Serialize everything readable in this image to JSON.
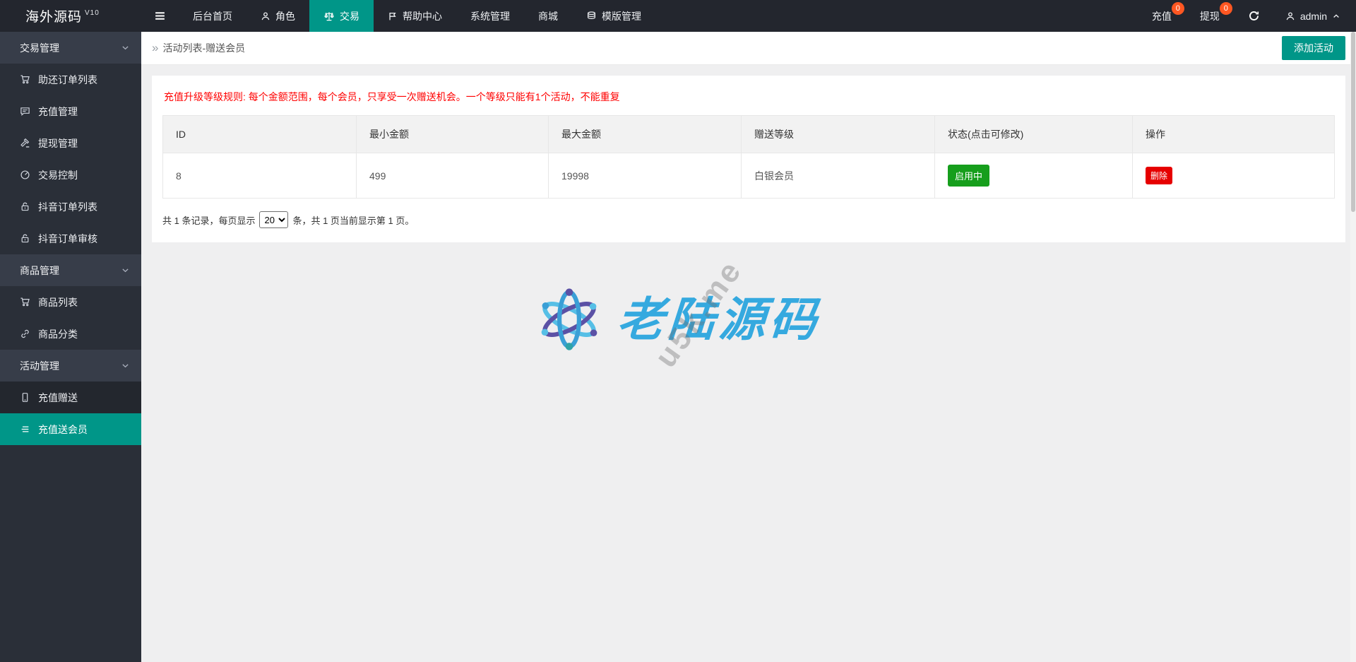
{
  "topbar": {
    "logo_text": "海外源码",
    "logo_version": "V10",
    "nav": [
      {
        "label": "后台首页"
      },
      {
        "label": "角色",
        "icon": "user-icon"
      },
      {
        "label": "交易",
        "icon": "scales-icon",
        "active": true
      },
      {
        "label": "帮助中心",
        "icon": "flag-icon"
      },
      {
        "label": "系统管理"
      },
      {
        "label": "商城"
      },
      {
        "label": "模版管理",
        "icon": "layers-icon"
      }
    ],
    "quick_actions": [
      {
        "label": "充值",
        "badge": "0"
      },
      {
        "label": "提现",
        "badge": "0"
      }
    ],
    "refresh_icon": "refresh-icon",
    "user": {
      "name": "admin",
      "icon": "user-icon",
      "chevron": "chevron-up-icon"
    }
  },
  "sidebar": {
    "items": [
      {
        "type": "group",
        "label": "交易管理",
        "chevron": "chevron-down-icon"
      },
      {
        "type": "item",
        "label": "助还订单列表",
        "icon": "cart-icon"
      },
      {
        "type": "item",
        "label": "充值管理",
        "icon": "comment-icon"
      },
      {
        "type": "item",
        "label": "提现管理",
        "icon": "gavel-icon"
      },
      {
        "type": "item",
        "label": "交易控制",
        "icon": "gauge-icon"
      },
      {
        "type": "item",
        "label": "抖音订单列表",
        "icon": "lock-icon"
      },
      {
        "type": "item",
        "label": "抖音订单审核",
        "icon": "lock-icon"
      },
      {
        "type": "group",
        "label": "商品管理",
        "chevron": "chevron-down-icon"
      },
      {
        "type": "item",
        "label": "商品列表",
        "icon": "cart-icon"
      },
      {
        "type": "item",
        "label": "商品分类",
        "icon": "link-icon"
      },
      {
        "type": "group",
        "label": "活动管理",
        "chevron": "chevron-down-icon"
      },
      {
        "type": "item",
        "label": "充值赠送",
        "icon": "mobile-icon"
      },
      {
        "type": "item",
        "label": "充值送会员",
        "icon": "list-icon",
        "active": true
      }
    ]
  },
  "breadcrumb": {
    "title": "活动列表-赠送会员",
    "add_button_label": "添加活动"
  },
  "content": {
    "notice": "充值升级等级规则: 每个金额范围，每个会员，只享受一次赠送机会。一个等级只能有1个活动，不能重复",
    "table": {
      "headers": [
        "ID",
        "最小金额",
        "最大金额",
        "赠送等级",
        "状态(点击可修改)",
        "操作"
      ],
      "rows": [
        {
          "id": "8",
          "min_amount": "499",
          "max_amount": "19998",
          "level": "白银会员",
          "status_label": "启用中",
          "action_label": "删除"
        }
      ]
    },
    "pagination": {
      "prefix": "共 1 条记录，每页显示",
      "page_size": "20",
      "suffix": "条，共 1 页当前显示第 1 页。"
    }
  },
  "watermark": {
    "brand_text": "老陆源码",
    "diagonal_text": "u5k.me",
    "logo_icon": "atom-logo-icon"
  },
  "colors": {
    "accent_teal": "#009688",
    "topbar_bg": "#23262E",
    "sidebar_bg": "#2A2F38",
    "sidebar_group_bg": "#373D49",
    "badge_orange": "#FF5722",
    "notice_red": "#FF0000",
    "status_green": "#169E1C",
    "delete_red": "#E60000",
    "watermark_blue": "#35A9DF"
  }
}
